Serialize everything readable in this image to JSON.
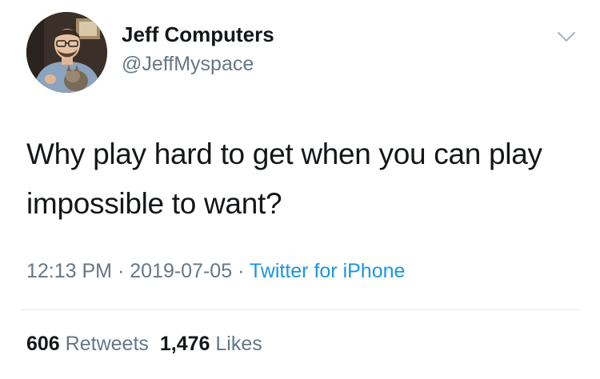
{
  "author": {
    "display_name": "Jeff Computers",
    "handle": "@JeffMyspace"
  },
  "tweet": {
    "text": "Why play hard to get when you can play impossible to want?",
    "time": "12:13 PM",
    "separator": " · ",
    "date": "2019-07-05",
    "source": "Twitter for iPhone"
  },
  "stats": {
    "retweets_count": "606",
    "retweets_label": "Retweets",
    "likes_count": "1,476",
    "likes_label": "Likes"
  },
  "icons": {
    "menu": "chevron-down-icon",
    "avatar": "profile-photo"
  },
  "colors": {
    "text": "#14171a",
    "secondary": "#657786",
    "link": "#1b95e0",
    "divider": "#e1e8ed"
  }
}
